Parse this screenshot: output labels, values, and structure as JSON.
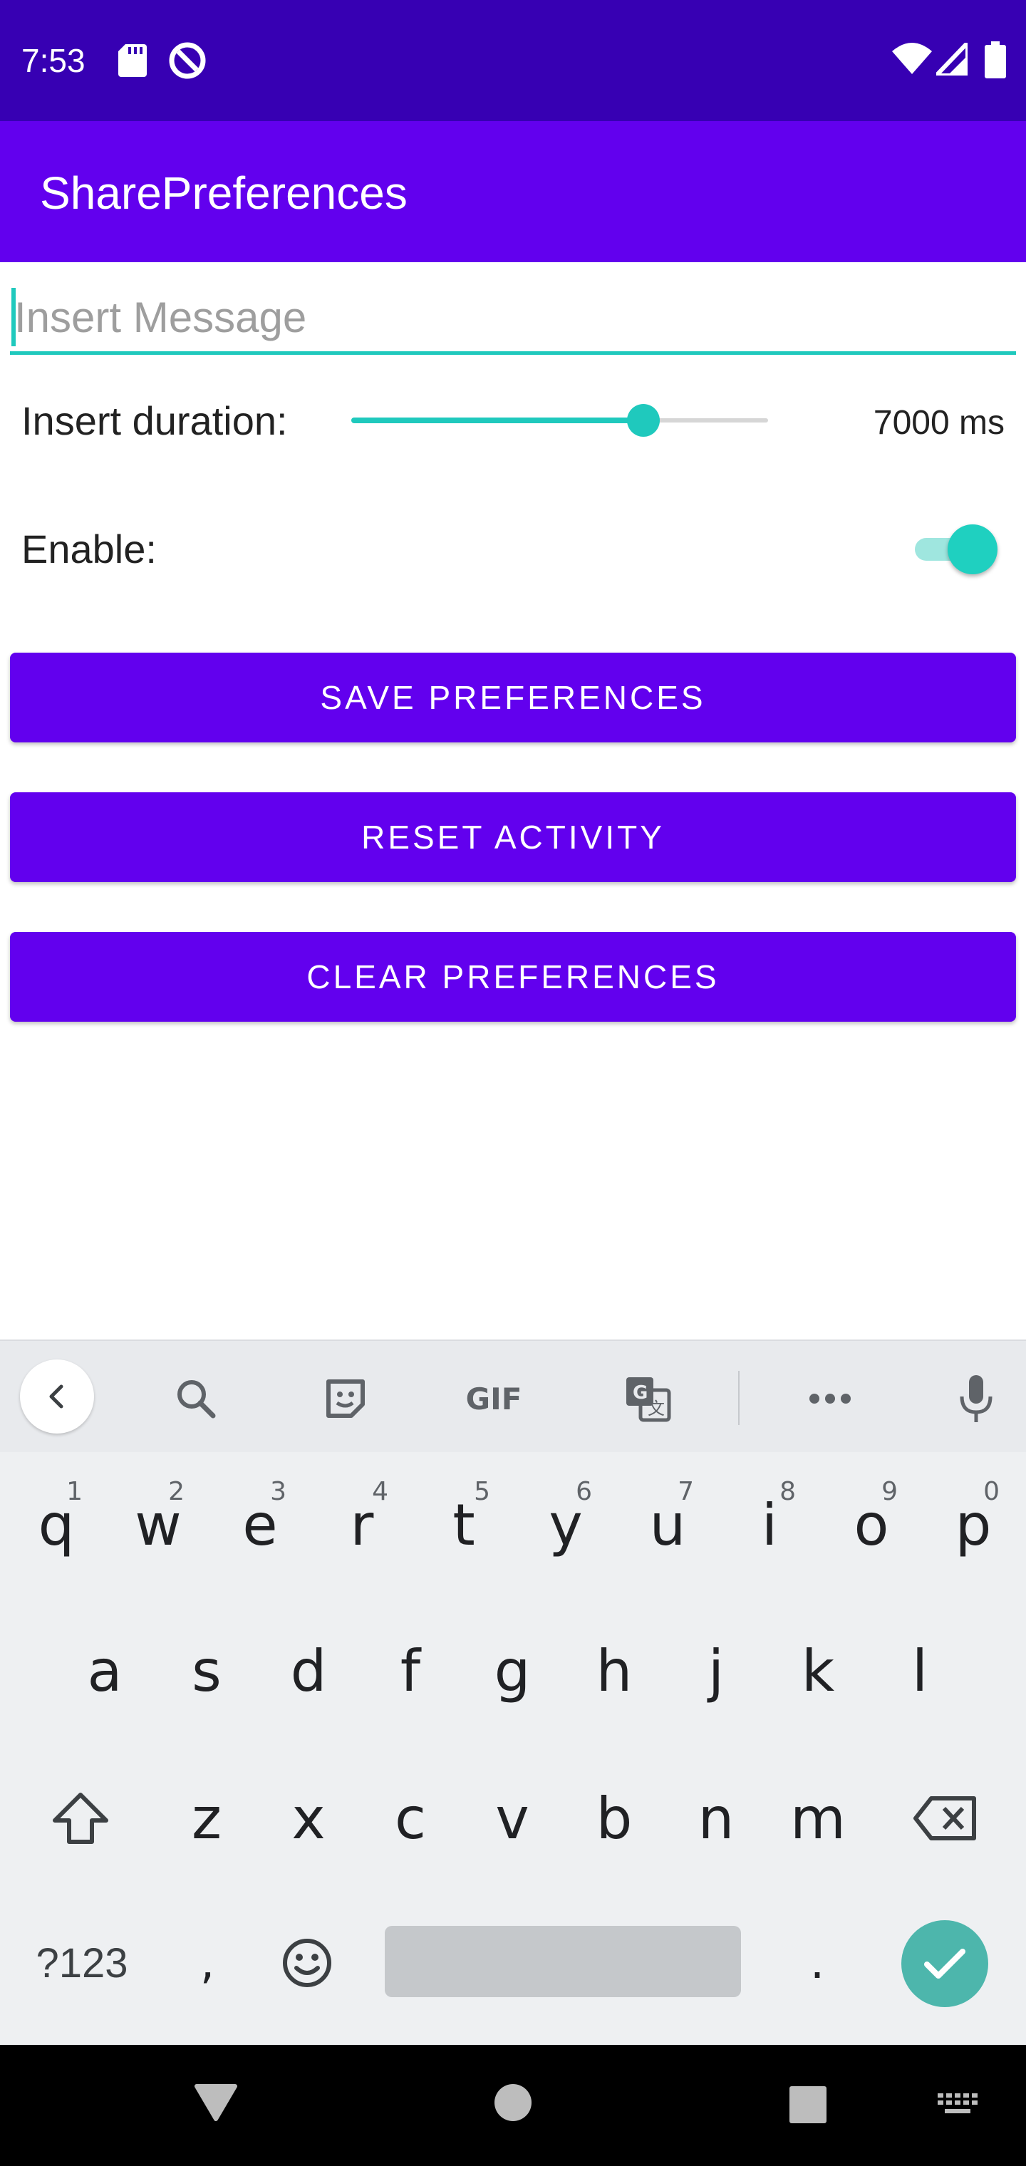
{
  "status_bar": {
    "time": "7:53",
    "icons": [
      "sd-card-icon",
      "data-saver-icon",
      "wifi-icon",
      "signal-icon",
      "battery-icon"
    ]
  },
  "app_bar": {
    "title": "SharePreferences"
  },
  "form": {
    "message_placeholder": "Insert Message",
    "message_value": "",
    "duration_label": "Insert duration:",
    "duration_value_text": "7000 ms",
    "duration_slider_fraction": 0.7,
    "enable_label": "Enable:",
    "enable_on": true
  },
  "buttons": {
    "save": "SAVE PREFERENCES",
    "reset": "RESET ACTIVITY",
    "clear": "CLEAR PREFERENCES"
  },
  "keyboard": {
    "toolbar_icons": [
      "back-icon",
      "search-icon",
      "sticker-icon",
      "gif-icon",
      "translate-icon",
      "more-icon",
      "mic-icon"
    ],
    "gif_label": "GIF",
    "row1": [
      {
        "key": "q",
        "hint": "1"
      },
      {
        "key": "w",
        "hint": "2"
      },
      {
        "key": "e",
        "hint": "3"
      },
      {
        "key": "r",
        "hint": "4"
      },
      {
        "key": "t",
        "hint": "5"
      },
      {
        "key": "y",
        "hint": "6"
      },
      {
        "key": "u",
        "hint": "7"
      },
      {
        "key": "i",
        "hint": "8"
      },
      {
        "key": "o",
        "hint": "9"
      },
      {
        "key": "p",
        "hint": "0"
      }
    ],
    "row2": [
      "a",
      "s",
      "d",
      "f",
      "g",
      "h",
      "j",
      "k",
      "l"
    ],
    "row3": [
      "z",
      "x",
      "c",
      "v",
      "b",
      "n",
      "m"
    ],
    "symbols_label": "?123",
    "comma": ",",
    "period": "."
  },
  "colors": {
    "status_bar": "#3700b3",
    "app_bar": "#6200ee",
    "accent": "#1fc9bd",
    "button": "#6200ee",
    "enter_key": "#4db6ac"
  }
}
